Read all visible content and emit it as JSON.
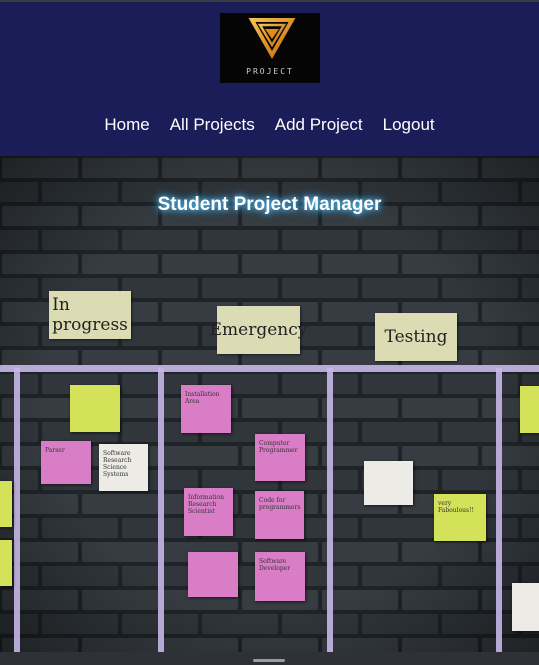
{
  "header": {
    "logo_text": "PROJECT",
    "nav": [
      {
        "label": "Home"
      },
      {
        "label": "All Projects"
      },
      {
        "label": "Add Project"
      },
      {
        "label": "Logout"
      }
    ]
  },
  "hero": {
    "title": "Student Project Manager",
    "columns": [
      "In progress",
      "Emergency",
      "Testing"
    ],
    "notes": [
      {
        "text": "Parser"
      },
      {
        "text": "Software Research Science Systems"
      },
      {
        "text": "Installation Area"
      },
      {
        "text": "Computer Programmer"
      },
      {
        "text": "Information Research Scientist"
      },
      {
        "text": "Code for programmers"
      },
      {
        "text": "Software Developer"
      },
      {
        "text": "very Faboulous!!"
      }
    ]
  },
  "colors": {
    "header_bg": "#1b1d58",
    "title_glow": "#63d0ff",
    "pink_note": "#d97dc6",
    "yellow_note": "#d4e25a",
    "tape": "#c7b7e8"
  }
}
